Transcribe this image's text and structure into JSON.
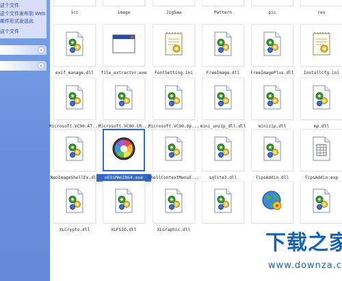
{
  "taskpane": {
    "links": [
      "这个文件",
      "这个文件发布到 Web",
      "邮件形式发送此",
      "这个文件"
    ],
    "sections": [
      "",
      ""
    ]
  },
  "rows_top": [
    "icc",
    "image",
    "JigSaw",
    "Pattern",
    "pic",
    "res"
  ],
  "files": [
    {
      "label": "exif_manage.dll",
      "icon": "dll-gear-icon"
    },
    {
      "label": "file_extractor.exe",
      "icon": "window-exe-icon"
    },
    {
      "label": "FontSetting.ini",
      "icon": "ini-settings-icon"
    },
    {
      "label": "FreeImage.dll",
      "icon": "dll-gear-icon"
    },
    {
      "label": "FreeImagePlus.dll",
      "icon": "dll-gear-icon"
    },
    {
      "label": "InstallCfg.ini",
      "icon": "ini-settings-icon"
    },
    {
      "label": "Microsoft.VC90.AT...",
      "icon": "dll-gear-icon"
    },
    {
      "label": "Microsoft.VC90.CR...",
      "icon": "dll-gear-icon"
    },
    {
      "label": "Microsoft.VC90.Op...",
      "icon": "dll-gear-icon"
    },
    {
      "label": "mini_unzip_dll.dll",
      "icon": "dll-gear-icon"
    },
    {
      "label": "minizip.dll",
      "icon": "dll-gear-icon"
    },
    {
      "label": "mp.dll",
      "icon": "dll-gear-icon"
    },
    {
      "label": "NeoImageShellEx.dll",
      "icon": "dll-gear-icon"
    },
    {
      "label": "nEOiMAGING4.exe",
      "icon": "neoimaging-aperture-icon",
      "selected": true
    },
    {
      "label": "ShellContextMenuE...",
      "icon": "dll-gear-icon"
    },
    {
      "label": "sqlite3.dll",
      "icon": "dll-gear-icon"
    },
    {
      "label": "TipsAddin.dll",
      "icon": "dll-gear-icon"
    },
    {
      "label": "TipsAddin.exp",
      "icon": "exp-file-icon"
    },
    {
      "label": "XLCrypto.dll",
      "icon": "dll-gear-icon"
    },
    {
      "label": "XLFSIO.dll",
      "icon": "dll-gear-icon"
    },
    {
      "label": "XLGraphic.dll",
      "icon": "dll-gear-icon"
    },
    {
      "label": "",
      "icon": "dll-gear-icon"
    },
    {
      "label": "",
      "icon": "globe-exe-icon"
    },
    {
      "label": "",
      "icon": "dll-gear-icon"
    }
  ],
  "watermark": {
    "title": "下载之家",
    "url": "www.downza.cn"
  }
}
